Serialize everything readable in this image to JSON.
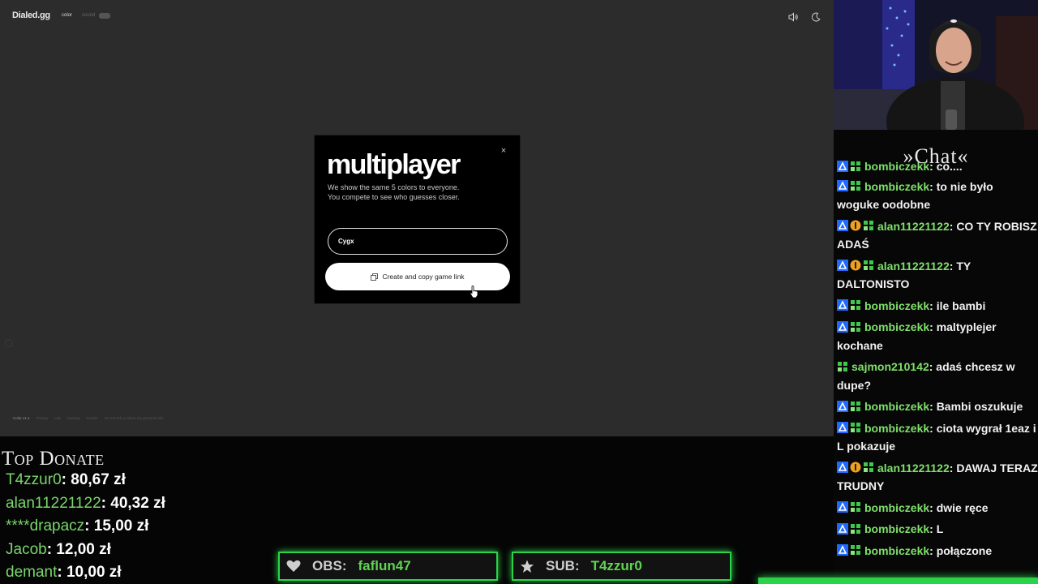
{
  "game": {
    "brand": "Dialed.gg",
    "nav_color": "color",
    "nav_sound": "sound",
    "footer_links": [
      "Color v1.4",
      "Privacy",
      "Lab",
      "Scoring",
      "Socials",
      "Do not sell or share my personal info"
    ]
  },
  "modal": {
    "title": "multiplayer",
    "desc_line1": "We show the same 5 colors to everyone.",
    "desc_line2": "You compete to see who guesses closer.",
    "name_value": "Cygx",
    "create_label": "Create and copy game link"
  },
  "chat": {
    "title": "»Chat«",
    "messages": [
      {
        "badges": [
          "prime",
          "sub"
        ],
        "user": "bombiczekk",
        "text": ": co...."
      },
      {
        "badges": [
          "prime",
          "sub"
        ],
        "user": "bombiczekk",
        "text": ": to nie było woguke oodobne"
      },
      {
        "badges": [
          "prime",
          "bits",
          "sub"
        ],
        "user": "alan11221122",
        "text": ": CO TY ROBISZ ADAŚ"
      },
      {
        "badges": [
          "prime",
          "bits",
          "sub"
        ],
        "user": "alan11221122",
        "text": ": TY DALTONISTO"
      },
      {
        "badges": [
          "prime",
          "sub"
        ],
        "user": "bombiczekk",
        "text": ": ile bambi"
      },
      {
        "badges": [
          "prime",
          "sub"
        ],
        "user": "bombiczekk",
        "text": ": maltyplejer kochane"
      },
      {
        "badges": [
          "sub"
        ],
        "user": "sajmon210142",
        "text": ": adaś chcesz w dupe?"
      },
      {
        "badges": [
          "prime",
          "sub"
        ],
        "user": "bombiczekk",
        "text": ": Bambi oszukuje"
      },
      {
        "badges": [
          "prime",
          "sub"
        ],
        "user": "bombiczekk",
        "text": ": ciota wygrał 1eaz i L pokazuje"
      },
      {
        "badges": [
          "prime",
          "bits",
          "sub"
        ],
        "user": "alan11221122",
        "text": ": DAWAJ TERAZ TRUDNY"
      },
      {
        "badges": [
          "prime",
          "sub"
        ],
        "user": "bombiczekk",
        "text": ": dwie ręce"
      },
      {
        "badges": [
          "prime",
          "sub"
        ],
        "user": "bombiczekk",
        "text": ": L"
      },
      {
        "badges": [
          "prime",
          "sub"
        ],
        "user": "bombiczekk",
        "text": ": połączone"
      }
    ]
  },
  "donate": {
    "title": "Top Donate",
    "entries": [
      {
        "name": "T4zzur0",
        "amount": ": 80,67 zł"
      },
      {
        "name": "alan11221122",
        "amount": ": 40,32 zł"
      },
      {
        "name": "****drapacz",
        "amount": ": 15,00 zł"
      },
      {
        "name": "Jacob",
        "amount": ": 12,00 zł"
      },
      {
        "name": "demant",
        "amount": ": 10,00 zł"
      }
    ]
  },
  "obs": {
    "label": "OBS:",
    "value": "faflun47",
    "icon": "heart-icon"
  },
  "sub": {
    "label": "SUB:",
    "value": "T4zzur0",
    "icon": "star-icon"
  },
  "colors": {
    "accent_green": "#2cd34a",
    "username_green": "#7fe06a",
    "modal_bg": "#000000",
    "game_bg": "#2c2c2c"
  }
}
